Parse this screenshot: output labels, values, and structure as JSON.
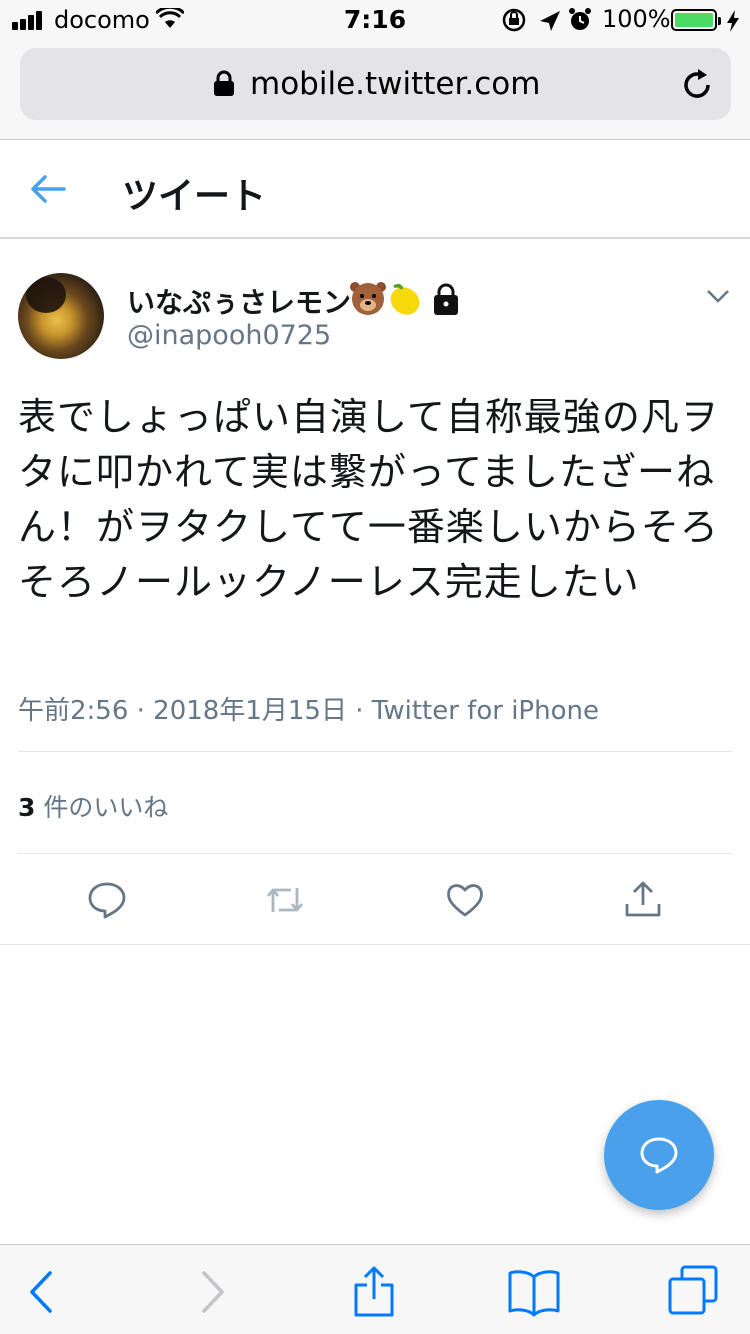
{
  "status_bar": {
    "carrier": "docomo",
    "time": "7:16",
    "battery_percent": "100%",
    "battery_level": 1.0,
    "battery_color": "#4cd964"
  },
  "browser": {
    "url": "mobile.twitter.com"
  },
  "header": {
    "title": "ツイート"
  },
  "tweet": {
    "display_name": "いなぷぅさレモン",
    "name_emojis": [
      "bear-face-icon",
      "lemon-icon",
      "lock-icon"
    ],
    "handle": "@inapooh0725",
    "text": "表でしょっぱい自演して自称最強の凡ヲタに叩かれて実は繋がってましたざーねん！がヲタクしてて一番楽しいからそろそろノールックノーレス完走したい",
    "meta": "午前2:56 · 2018年1月15日 · Twitter for iPhone",
    "likes_count": "3",
    "likes_label_prefix": " 件の",
    "likes_label": "いいね",
    "actions": [
      "reply-icon",
      "retweet-icon",
      "like-icon",
      "share-icon"
    ]
  },
  "colors": {
    "accent": "#4aa1eb",
    "secondary_text": "#657786",
    "primary_text": "#14171a",
    "ios_blue": "#007aff"
  }
}
